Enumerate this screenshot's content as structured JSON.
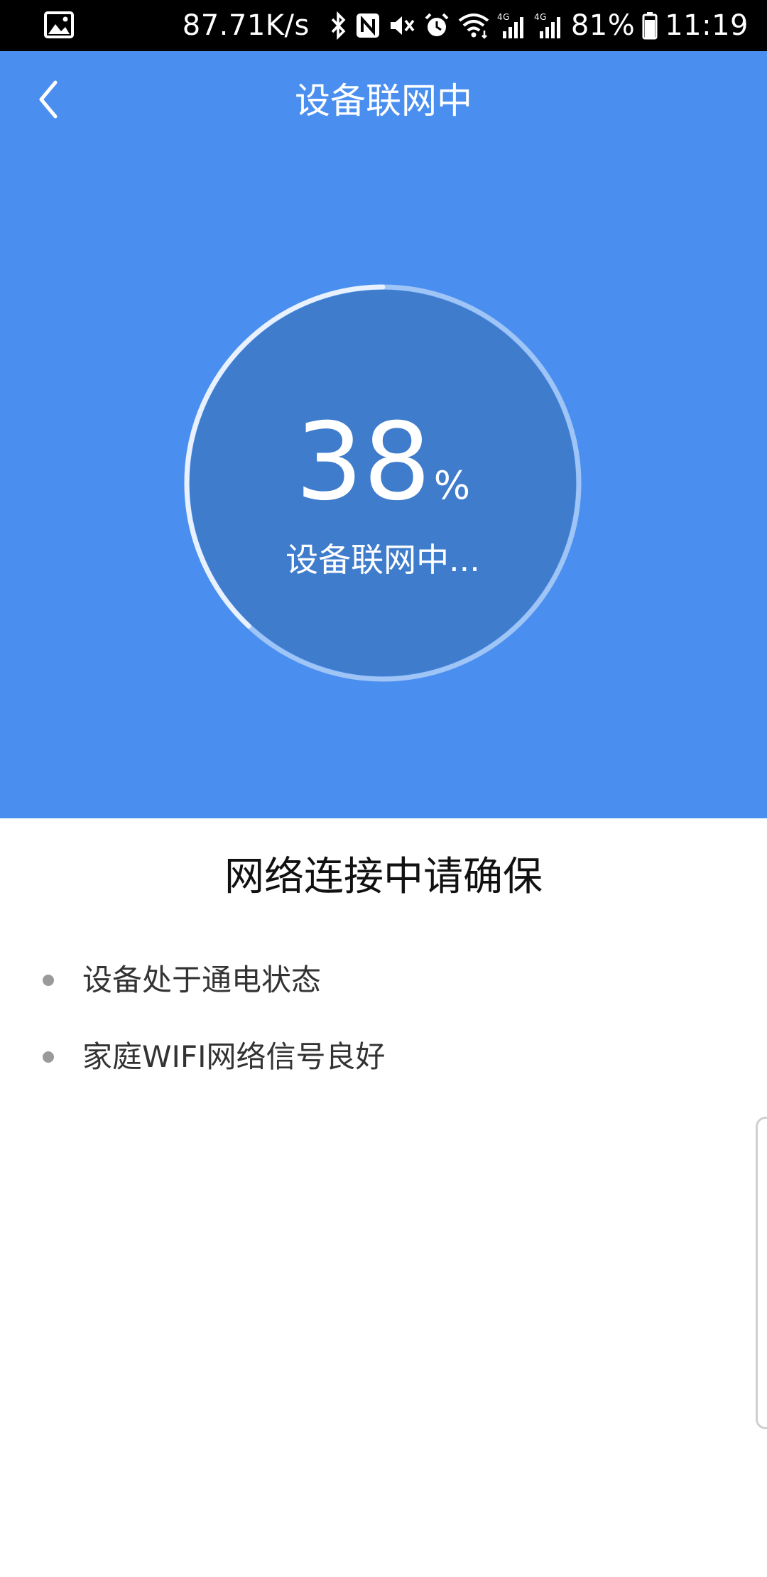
{
  "status_bar": {
    "network_speed": "87.71K/s",
    "net_type_1": "4G",
    "net_type_2": "4G",
    "battery": "81%",
    "time": "11:19",
    "icons": [
      "image-icon",
      "bluetooth-icon",
      "nfc-icon",
      "mute-icon",
      "alarm-icon",
      "wifi-icon",
      "signal-icon",
      "battery-icon"
    ]
  },
  "navbar": {
    "title": "设备联网中",
    "back_icon": "chevron-left-icon"
  },
  "progress": {
    "value": "38",
    "percent_sign": "%",
    "fraction": 0.38,
    "label": "设备联网中..."
  },
  "tips": {
    "title": "网络连接中请确保",
    "items": [
      {
        "text": "设备处于通电状态"
      },
      {
        "text": "家庭WIFI网络信号良好"
      }
    ]
  },
  "colors": {
    "header_bg": "#4a8ff0",
    "circle_fill": "#3f7ccc",
    "ring_track": "#9fc4f6",
    "ring_progress": "#e8f1fd",
    "text_dark": "#111111",
    "text_body": "#333333",
    "bullet": "#9a9a9a"
  }
}
